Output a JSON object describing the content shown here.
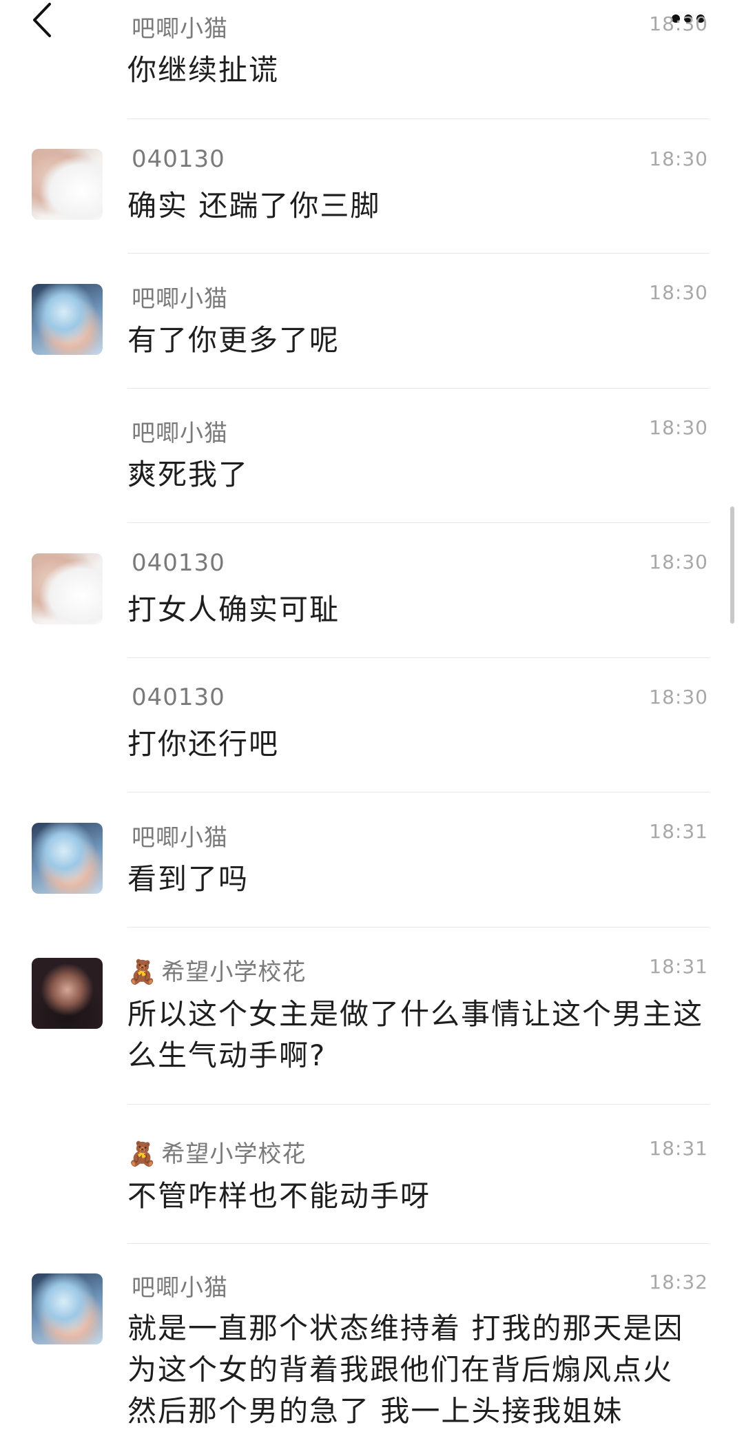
{
  "messages": [
    {
      "id": 1,
      "sender": "吧唧小猫",
      "time": "18:30",
      "text": "你继续扯谎",
      "avatar": "none",
      "emoji": ""
    },
    {
      "id": 2,
      "sender": "040130",
      "time": "18:30",
      "text": "确实 还踹了你三脚",
      "avatar": "white-dress",
      "emoji": ""
    },
    {
      "id": 3,
      "sender": "吧唧小猫",
      "time": "18:30",
      "text": "有了你更多了呢",
      "avatar": "blue-hair",
      "emoji": ""
    },
    {
      "id": 4,
      "sender": "吧唧小猫",
      "time": "18:30",
      "text": "爽死我了",
      "avatar": "none",
      "emoji": ""
    },
    {
      "id": 5,
      "sender": "040130",
      "time": "18:30",
      "text": "打女人确实可耻",
      "avatar": "white-dress",
      "emoji": ""
    },
    {
      "id": 6,
      "sender": "040130",
      "time": "18:30",
      "text": "打你还行吧",
      "avatar": "none",
      "emoji": ""
    },
    {
      "id": 7,
      "sender": "吧唧小猫",
      "time": "18:31",
      "text": "看到了吗",
      "avatar": "blue-hair",
      "emoji": ""
    },
    {
      "id": 8,
      "sender": "希望小学校花",
      "time": "18:31",
      "text": "所以这个女主是做了什么事情让这个男主这么生气动手啊?",
      "avatar": "dark-girl",
      "emoji": "🧸"
    },
    {
      "id": 9,
      "sender": "希望小学校花",
      "time": "18:31",
      "text": "不管咋样也不能动手呀",
      "avatar": "none",
      "emoji": "🧸"
    },
    {
      "id": 10,
      "sender": "吧唧小猫",
      "time": "18:32",
      "text": "就是一直那个状态维持着 打我的那天是因为这个女的背着我跟他们在背后煽风点火 然后那个男的急了 我一上头接我姐妹",
      "avatar": "blue-hair",
      "emoji": ""
    }
  ],
  "icons": {
    "back": "chevron-left-icon",
    "more": "more-icon"
  }
}
